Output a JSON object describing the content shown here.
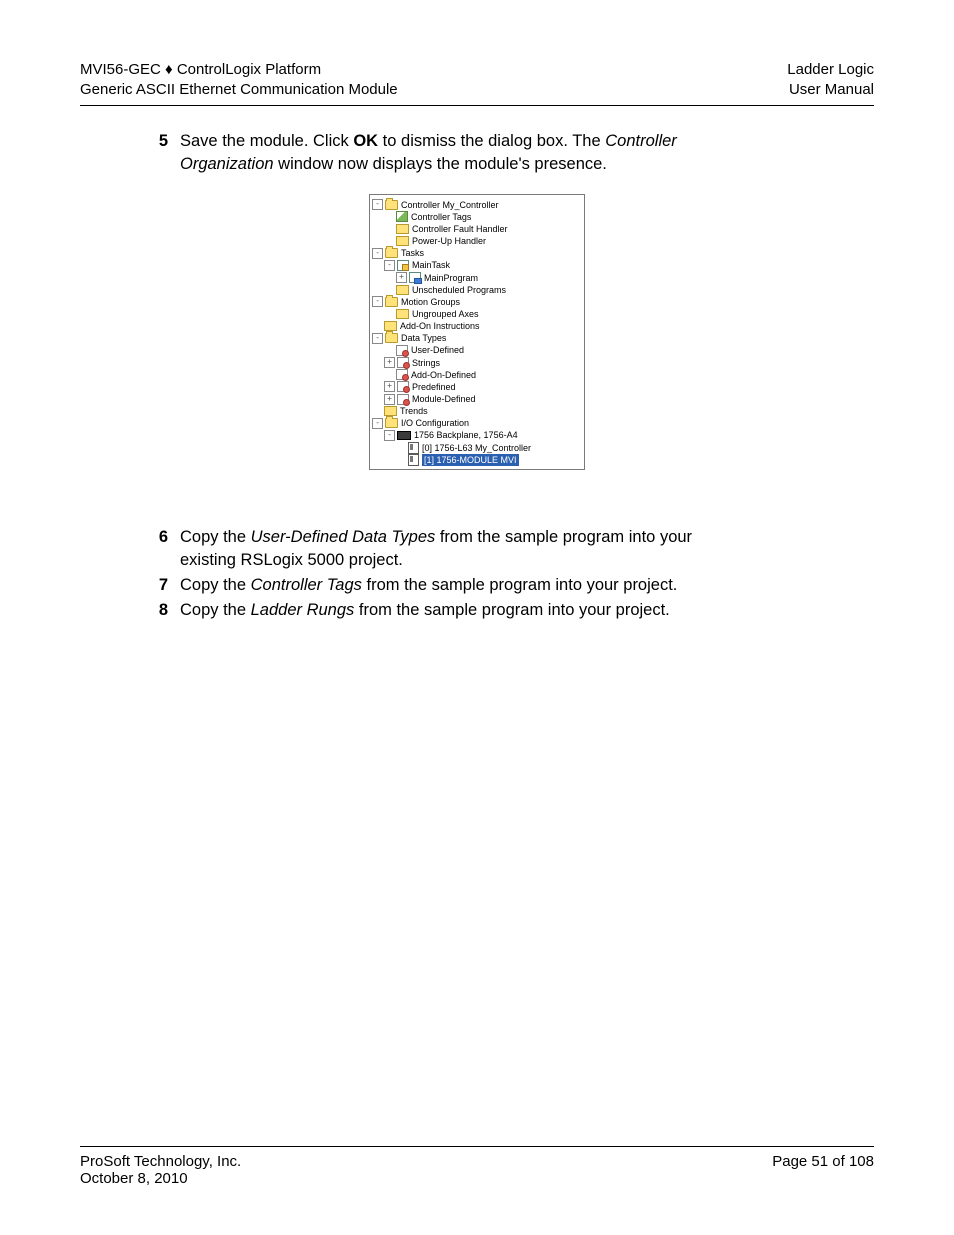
{
  "header": {
    "left_line1": "MVI56-GEC ♦ ControlLogix Platform",
    "left_line2": "Generic ASCII Ethernet Communication Module",
    "right_line1": "Ladder Logic",
    "right_line2": "User Manual"
  },
  "steps": {
    "s5": {
      "num": "5",
      "pre": "Save the module. Click ",
      "bold": "OK",
      "mid": " to dismiss the dialog box. The ",
      "ital1": "Controller Organization",
      "post": " window now displays the module's presence."
    },
    "s6": {
      "num": "6",
      "pre": "Copy the ",
      "ital": "User-Defined Data Types",
      "post": " from the sample program into your existing RSLogix 5000 project."
    },
    "s7": {
      "num": "7",
      "pre": "Copy the ",
      "ital": "Controller Tags",
      "post": " from the sample program into your project."
    },
    "s8": {
      "num": "8",
      "pre": "Copy the ",
      "ital": "Ladder Rungs",
      "post": " from the sample program into your project."
    }
  },
  "tree": {
    "controller": "Controller My_Controller",
    "controller_tags": "Controller Tags",
    "fault_handler": "Controller Fault Handler",
    "powerup": "Power-Up Handler",
    "tasks": "Tasks",
    "maintask": "MainTask",
    "mainprogram": "MainProgram",
    "unscheduled": "Unscheduled Programs",
    "motion_groups": "Motion Groups",
    "ungrouped_axes": "Ungrouped Axes",
    "addon_instr": "Add-On Instructions",
    "data_types": "Data Types",
    "user_defined": "User-Defined",
    "strings": "Strings",
    "addon_defined": "Add-On-Defined",
    "predefined": "Predefined",
    "module_defined": "Module-Defined",
    "trends": "Trends",
    "io_config": "I/O Configuration",
    "backplane": "1756 Backplane, 1756-A4",
    "slot0": "[0] 1756-L63 My_Controller",
    "slot1": "[1] 1756-MODULE MVI"
  },
  "footer": {
    "company": "ProSoft Technology, Inc.",
    "date": "October 8, 2010",
    "page": "Page 51 of 108"
  }
}
